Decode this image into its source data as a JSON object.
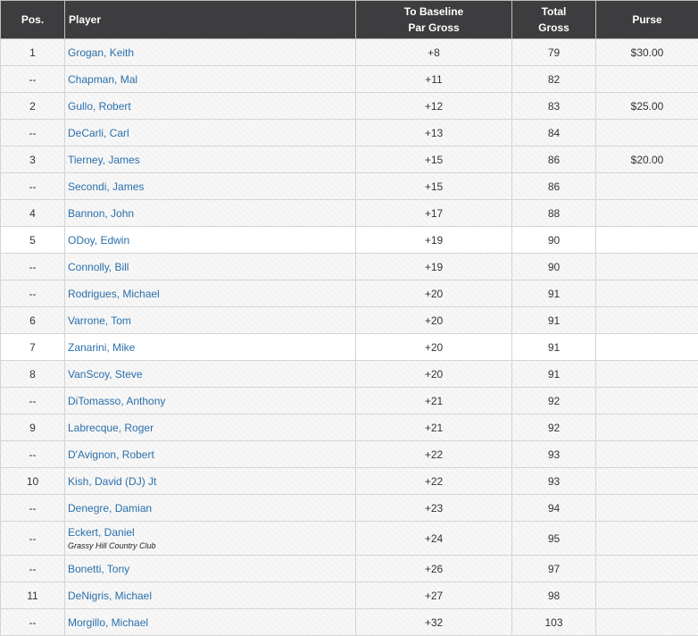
{
  "header": {
    "pos": "Pos.",
    "player": "Player",
    "tobase_line1": "To Baseline",
    "tobase_line2": "Par Gross",
    "total_line1": "Total",
    "total_line2": "Gross",
    "purse": "Purse"
  },
  "rows": [
    {
      "pos": "1",
      "player": "Grogan, Keith",
      "club": "",
      "tobase": "+8",
      "total": "79",
      "purse": "$30.00",
      "bg": "shaded"
    },
    {
      "pos": "--",
      "player": "Chapman, Mal",
      "club": "",
      "tobase": "+11",
      "total": "82",
      "purse": "",
      "bg": "shaded"
    },
    {
      "pos": "2",
      "player": "Gullo, Robert",
      "club": "",
      "tobase": "+12",
      "total": "83",
      "purse": "$25.00",
      "bg": "shaded"
    },
    {
      "pos": "--",
      "player": "DeCarli, Carl",
      "club": "",
      "tobase": "+13",
      "total": "84",
      "purse": "",
      "bg": "shaded"
    },
    {
      "pos": "3",
      "player": "Tierney, James",
      "club": "",
      "tobase": "+15",
      "total": "86",
      "purse": "$20.00",
      "bg": "shaded"
    },
    {
      "pos": "--",
      "player": "Secondi, James",
      "club": "",
      "tobase": "+15",
      "total": "86",
      "purse": "",
      "bg": "shaded"
    },
    {
      "pos": "4",
      "player": "Bannon, John",
      "club": "",
      "tobase": "+17",
      "total": "88",
      "purse": "",
      "bg": "shaded"
    },
    {
      "pos": "5",
      "player": "ODoy, Edwin",
      "club": "",
      "tobase": "+19",
      "total": "90",
      "purse": "",
      "bg": "plain"
    },
    {
      "pos": "--",
      "player": "Connolly, Bill",
      "club": "",
      "tobase": "+19",
      "total": "90",
      "purse": "",
      "bg": "shaded"
    },
    {
      "pos": "--",
      "player": "Rodrigues, Michael",
      "club": "",
      "tobase": "+20",
      "total": "91",
      "purse": "",
      "bg": "shaded"
    },
    {
      "pos": "6",
      "player": "Varrone, Tom",
      "club": "",
      "tobase": "+20",
      "total": "91",
      "purse": "",
      "bg": "shaded"
    },
    {
      "pos": "7",
      "player": "Zanarini, Mike",
      "club": "",
      "tobase": "+20",
      "total": "91",
      "purse": "",
      "bg": "plain"
    },
    {
      "pos": "8",
      "player": "VanScoy, Steve",
      "club": "",
      "tobase": "+20",
      "total": "91",
      "purse": "",
      "bg": "shaded"
    },
    {
      "pos": "--",
      "player": "DiTomasso, Anthony",
      "club": "",
      "tobase": "+21",
      "total": "92",
      "purse": "",
      "bg": "shaded"
    },
    {
      "pos": "9",
      "player": "Labrecque, Roger",
      "club": "",
      "tobase": "+21",
      "total": "92",
      "purse": "",
      "bg": "shaded"
    },
    {
      "pos": "--",
      "player": "D'Avignon, Robert",
      "club": "",
      "tobase": "+22",
      "total": "93",
      "purse": "",
      "bg": "shaded"
    },
    {
      "pos": "10",
      "player": "Kish, David (DJ) Jt",
      "club": "",
      "tobase": "+22",
      "total": "93",
      "purse": "",
      "bg": "shaded"
    },
    {
      "pos": "--",
      "player": "Denegre, Damian",
      "club": "",
      "tobase": "+23",
      "total": "94",
      "purse": "",
      "bg": "shaded"
    },
    {
      "pos": "--",
      "player": "Eckert, Daniel",
      "club": "Grassy Hill Country Club",
      "tobase": "+24",
      "total": "95",
      "purse": "",
      "bg": "shaded"
    },
    {
      "pos": "--",
      "player": "Bonetti, Tony",
      "club": "",
      "tobase": "+26",
      "total": "97",
      "purse": "",
      "bg": "shaded"
    },
    {
      "pos": "11",
      "player": "DeNigris, Michael",
      "club": "",
      "tobase": "+27",
      "total": "98",
      "purse": "",
      "bg": "shaded"
    },
    {
      "pos": "--",
      "player": "Morgillo, Michael",
      "club": "",
      "tobase": "+32",
      "total": "103",
      "purse": "",
      "bg": "shaded"
    }
  ]
}
